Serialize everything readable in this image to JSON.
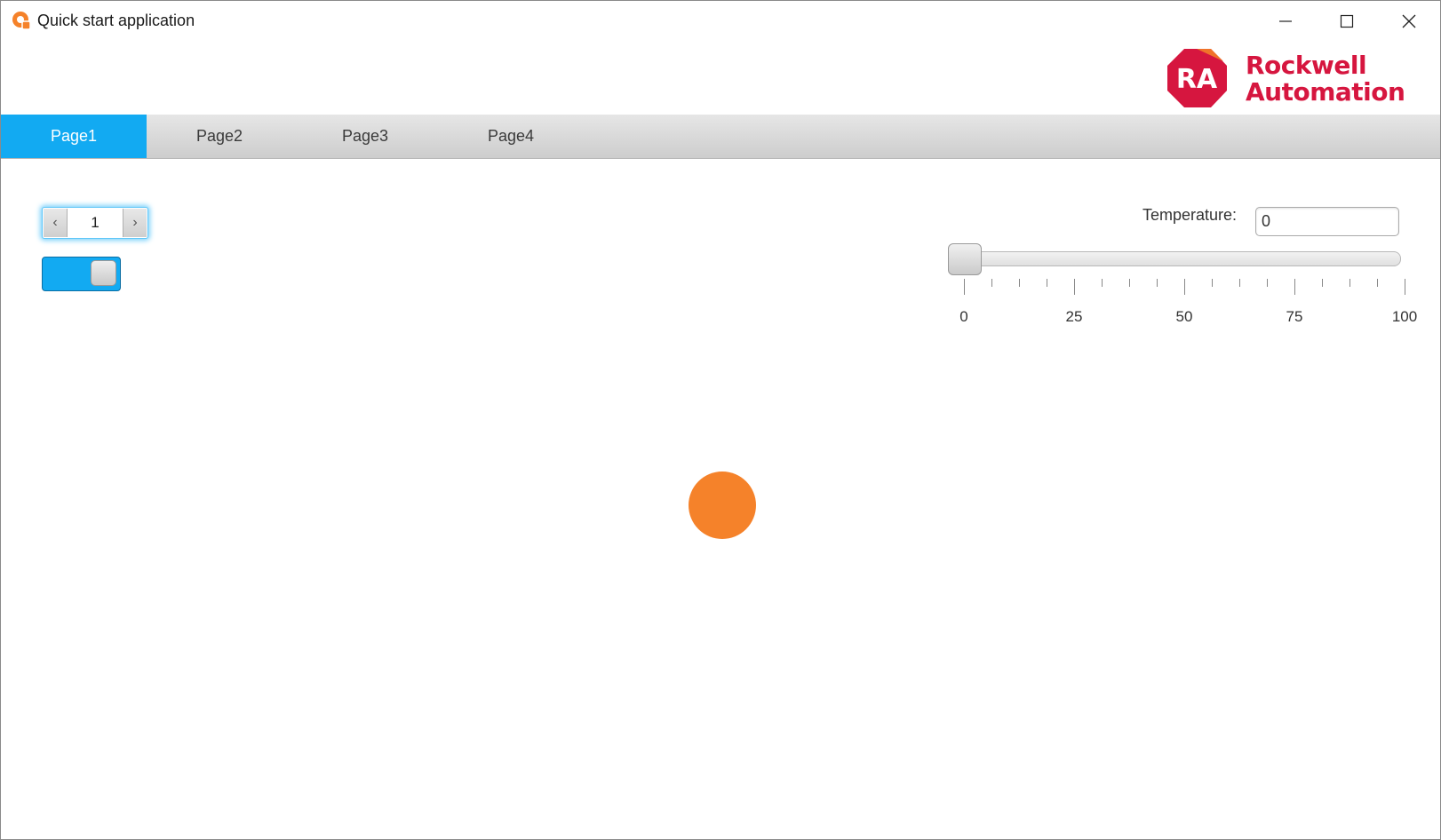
{
  "window": {
    "title": "Quick start application",
    "icon": "app-logo-icon",
    "controls": [
      "minimize-icon",
      "maximize-icon",
      "close-icon"
    ]
  },
  "logo": {
    "text_line1": "Rockwell",
    "text_line2": "Automation",
    "mark_text": "RA",
    "color": "#d6163f"
  },
  "tabs": [
    {
      "label": "Page1",
      "active": true
    },
    {
      "label": "Page2",
      "active": false
    },
    {
      "label": "Page3",
      "active": false
    },
    {
      "label": "Page4",
      "active": false
    }
  ],
  "spinbox": {
    "value": "1",
    "decrement": "‹",
    "increment": "›"
  },
  "toggle": {
    "state": "on",
    "color": "#12aaf2"
  },
  "temperature": {
    "label": "Temperature:",
    "value": "0"
  },
  "slider": {
    "min": 0,
    "max": 100,
    "value": 0,
    "tick_labels": [
      "0",
      "25",
      "50",
      "75",
      "100"
    ],
    "minor_ticks": 16
  },
  "indicator": {
    "color": "#f5822a"
  },
  "colors": {
    "accent": "#12aaf2",
    "brand": "#d6163f",
    "indicator": "#f5822a"
  }
}
